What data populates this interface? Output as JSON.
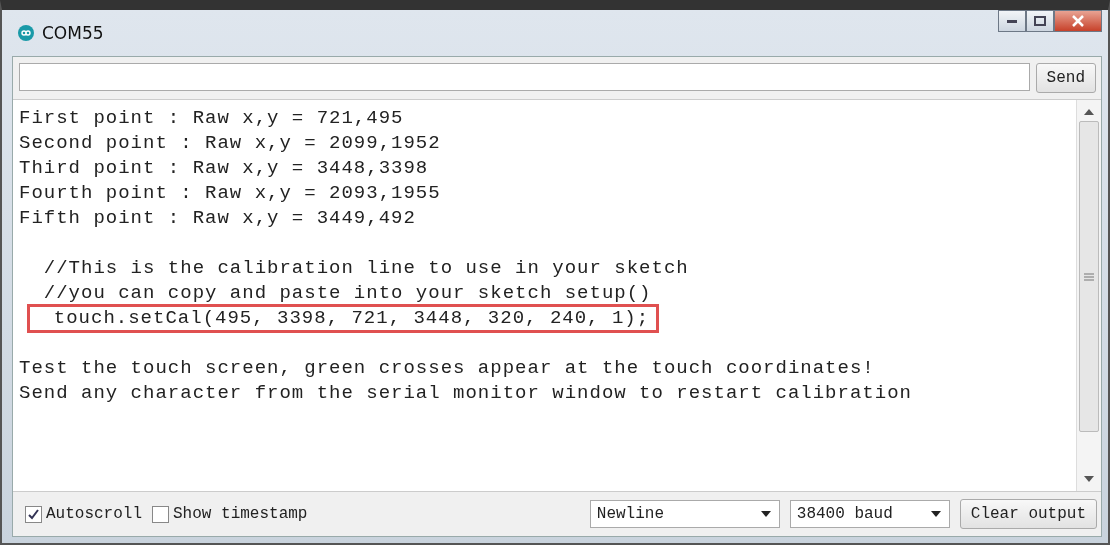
{
  "window": {
    "title": "COM55"
  },
  "input": {
    "send_label": "Send"
  },
  "output": {
    "blocks": [
      {
        "lines": [
          {
            "text": "First point : Raw x,y = 721,495",
            "highlighted": false
          },
          {
            "text": "Second point : Raw x,y = 2099,1952",
            "highlighted": false
          },
          {
            "text": "Third point : Raw x,y = 3448,3398",
            "highlighted": false
          },
          {
            "text": "Fourth point : Raw x,y = 2093,1955",
            "highlighted": false
          },
          {
            "text": "Fifth point : Raw x,y = 3449,492",
            "highlighted": false
          }
        ]
      },
      {
        "lines": [
          {
            "text": "  //This is the calibration line to use in your sketch",
            "highlighted": false
          },
          {
            "text": "  //you can copy and paste into your sketch setup()",
            "highlighted": false
          },
          {
            "text": "  touch.setCal(495, 3398, 721, 3448, 320, 240, 1);",
            "highlighted": true
          }
        ]
      },
      {
        "lines": [
          {
            "text": "Test the touch screen, green crosses appear at the touch coordinates!",
            "highlighted": false
          },
          {
            "text": "Send any character from the serial monitor window to restart calibration",
            "highlighted": false
          }
        ]
      }
    ]
  },
  "footer": {
    "autoscroll": {
      "label": "Autoscroll",
      "checked": true
    },
    "timestamp": {
      "label": "Show timestamp",
      "checked": false
    },
    "line_ending": "Newline",
    "baud": "38400 baud",
    "clear_label": "Clear output"
  }
}
